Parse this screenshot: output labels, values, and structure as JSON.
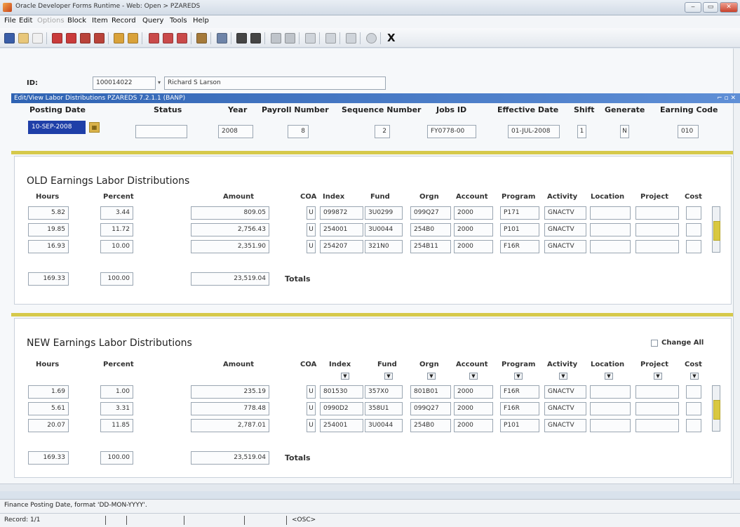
{
  "window": {
    "title": "Oracle Developer Forms Runtime - Web: Open > PZAREDS"
  },
  "menu": [
    "File",
    "Edit",
    "Options",
    "Block",
    "Item",
    "Record",
    "Query",
    "Tools",
    "Help"
  ],
  "toolbar": {
    "exit_label": "X"
  },
  "header": {
    "id_label": "ID:",
    "id_value": "100014022",
    "name_value": "Richard S Larson"
  },
  "form_title": "Edit/View Labor Distributions  PZAREDS  7.2.1.1  (BANP)",
  "key": {
    "labels": [
      "Posting Date",
      "Status",
      "Year",
      "Payroll Number",
      "Sequence Number",
      "Jobs ID",
      "Effective Date",
      "Shift",
      "Generate",
      "Earning Code"
    ],
    "posting_date": "10-SEP-2008",
    "status": "",
    "year": "2008",
    "payroll_number": "8",
    "sequence_number": "2",
    "jobs_id": "FY0778-00",
    "effective_date": "01-JUL-2008",
    "shift": "1",
    "generate": "N",
    "earning_code": "010"
  },
  "columns": [
    "Hours",
    "Percent",
    "Amount",
    "COA",
    "Index",
    "Fund",
    "Orgn",
    "Account",
    "Program",
    "Activity",
    "Location",
    "Project",
    "Cost"
  ],
  "old": {
    "title": "OLD Earnings Labor Distributions",
    "rows": [
      {
        "hours": "5.82",
        "percent": "3.44",
        "amount": "809.05",
        "coa": "U",
        "index": "099872",
        "fund": "3U0299",
        "orgn": "099Q27",
        "account": "2000",
        "program": "P171",
        "activity": "GNACTV"
      },
      {
        "hours": "19.85",
        "percent": "11.72",
        "amount": "2,756.43",
        "coa": "U",
        "index": "254001",
        "fund": "3U0044",
        "orgn": "254B0",
        "account": "2000",
        "program": "P101",
        "activity": "GNACTV"
      },
      {
        "hours": "16.93",
        "percent": "10.00",
        "amount": "2,351.90",
        "coa": "U",
        "index": "254207",
        "fund": "321N0",
        "orgn": "254B11",
        "account": "2000",
        "program": "F16R",
        "activity": "GNACTV"
      }
    ],
    "totals": {
      "hours": "169.33",
      "percent": "100.00",
      "amount": "23,519.04",
      "label": "Totals"
    }
  },
  "new": {
    "title": "NEW Earnings Labor Distributions",
    "change_all": "Change All",
    "rows": [
      {
        "hours": "1.69",
        "percent": "1.00",
        "amount": "235.19",
        "coa": "U",
        "index": "801530",
        "fund": "357X0",
        "orgn": "801B01",
        "account": "2000",
        "program": "F16R",
        "activity": "GNACTV"
      },
      {
        "hours": "5.61",
        "percent": "3.31",
        "amount": "778.48",
        "coa": "U",
        "index": "0990D2",
        "fund": "358U1",
        "orgn": "099Q27",
        "account": "2000",
        "program": "F16R",
        "activity": "GNACTV"
      },
      {
        "hours": "20.07",
        "percent": "11.85",
        "amount": "2,787.01",
        "coa": "U",
        "index": "254001",
        "fund": "3U0044",
        "orgn": "254B0",
        "account": "2000",
        "program": "P101",
        "activity": "GNACTV"
      }
    ],
    "totals": {
      "hours": "169.33",
      "percent": "100.00",
      "amount": "23,519.04",
      "label": "Totals"
    }
  },
  "status": {
    "hint": "Finance Posting Date, format 'DD-MON-YYYY'.",
    "record": "Record: 1/1",
    "osc": "<OSC>"
  },
  "colors": {
    "accent": "#2f63b3",
    "gold": "#d6c94b",
    "highlight": "#1f3fa8"
  }
}
